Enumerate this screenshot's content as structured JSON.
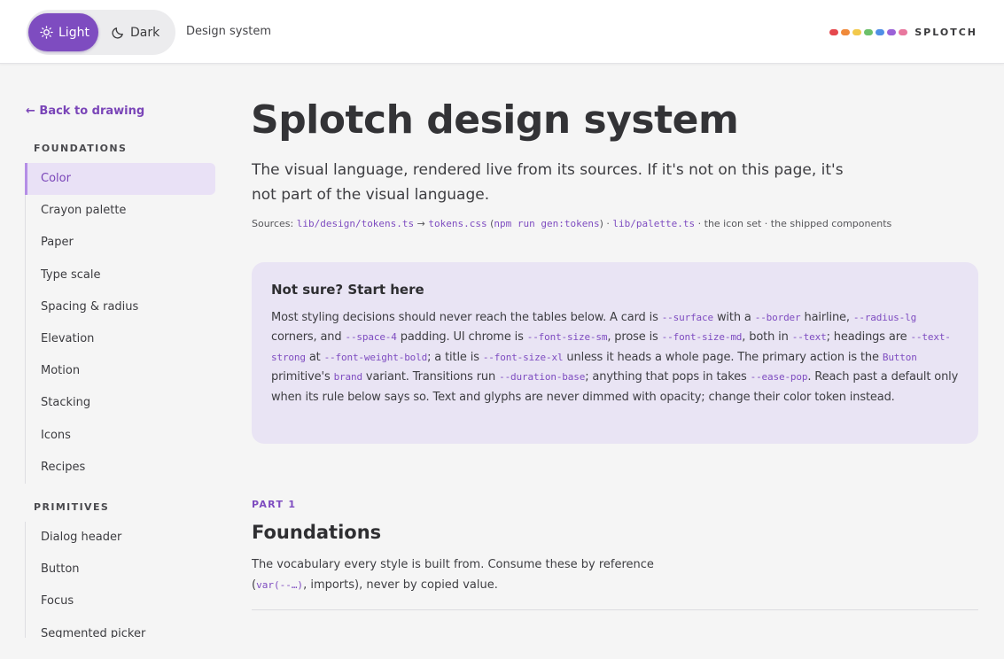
{
  "topbar": {
    "theme_light_label": "Light",
    "theme_dark_label": "Dark",
    "page_label": "Design system",
    "brand_name": "SPLOTCH",
    "brand_dots": [
      "#e5484d",
      "#f08a3a",
      "#f2c94c",
      "#6cc06a",
      "#4f8fe6",
      "#9b62d8",
      "#e8779e"
    ]
  },
  "sidebar": {
    "back_label": "← Back to drawing",
    "foundations_heading": "FOUNDATIONS",
    "foundations_items": [
      "Color",
      "Crayon palette",
      "Paper",
      "Type scale",
      "Spacing & radius",
      "Elevation",
      "Motion",
      "Stacking",
      "Icons",
      "Recipes"
    ],
    "primitives_heading": "PRIMITIVES",
    "primitives_items": [
      "Dialog header",
      "Button",
      "Focus",
      "Segmented picker"
    ]
  },
  "main": {
    "title": "Splotch design system",
    "lede": "The visual language, rendered live from its sources. If it's not on this page, it's not part of the visual language.",
    "sources": {
      "prefix": "Sources: ",
      "tokens_path": "lib/design/tokens.ts",
      "arrow": " → ",
      "tokens_css": "tokens.css",
      "paren_open": " (",
      "gen_cmd": "npm run gen:tokens",
      "paren_close": ") · ",
      "palette_path": "lib/palette.ts",
      "suffix": " · the icon set · the shipped components"
    },
    "callout": {
      "title": "Not sure? Start here",
      "t1": "Most styling decisions should never reach the tables below. A card is ",
      "c1": "--surface",
      "t2": " with a ",
      "c2": "--border",
      "t3": " hairline, ",
      "c3": "--radius-lg",
      "t4": " corners, and ",
      "c4": "--space-4",
      "t5": " padding. UI chrome is ",
      "c5": "--font-size-sm",
      "t6": ", prose is ",
      "c6": "--font-size-md",
      "t7": ", both in ",
      "c7": "--text",
      "t8": "; headings are ",
      "c8": "--text-strong",
      "t9": " at ",
      "c9": "--font-weight-bold",
      "t10": "; a title is ",
      "c10": "--font-size-xl",
      "t11": " unless it heads a whole page. The primary action is the ",
      "c11": "Button",
      "t12": " primitive's ",
      "c12": "brand",
      "t13": " variant. Transitions run ",
      "c13": "--duration-base",
      "t14": "; anything that pops in takes ",
      "c14": "--ease-pop",
      "t15": ". Reach past a default only when its rule below says so. Text and glyphs are never dimmed with opacity; change their color token instead."
    },
    "part_label": "PART 1",
    "section_title": "Foundations",
    "section_desc_1": "The vocabulary every style is built from. Consume these by reference (",
    "section_desc_code": "var(--…)",
    "section_desc_2": ", imports), never by copied value."
  }
}
